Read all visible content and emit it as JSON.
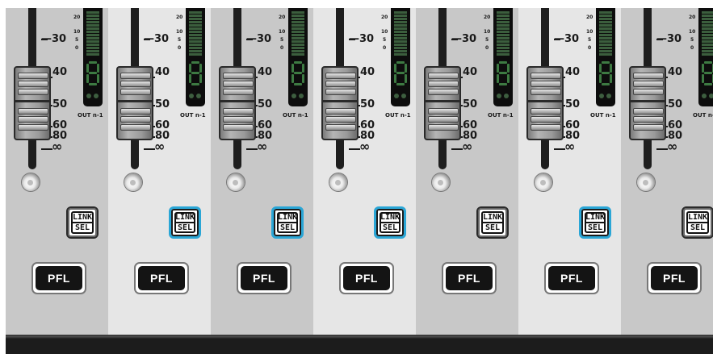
{
  "mixer": {
    "fader_scale": [
      "—30",
      "40",
      "50",
      "60",
      "80",
      "∞"
    ],
    "meter_scale": [
      "20",
      "10",
      "5",
      "0"
    ],
    "meter_digit": "8",
    "out_label": "OUT n-1",
    "link_label_top": "LINK",
    "link_label_bottom": "SEL",
    "pfl_label": "PFL",
    "colors": {
      "strip_dark": "#c8c8c8",
      "strip_light": "#e6e6e6",
      "link_active": "#2aa6d6",
      "meter_led": "#3d7a42"
    },
    "channels": [
      {
        "shade": "dark",
        "link_active": false
      },
      {
        "shade": "light",
        "link_active": true
      },
      {
        "shade": "dark",
        "link_active": true
      },
      {
        "shade": "light",
        "link_active": true
      },
      {
        "shade": "dark",
        "link_active": false
      },
      {
        "shade": "light",
        "link_active": true
      },
      {
        "shade": "dark",
        "link_active": false
      }
    ]
  }
}
